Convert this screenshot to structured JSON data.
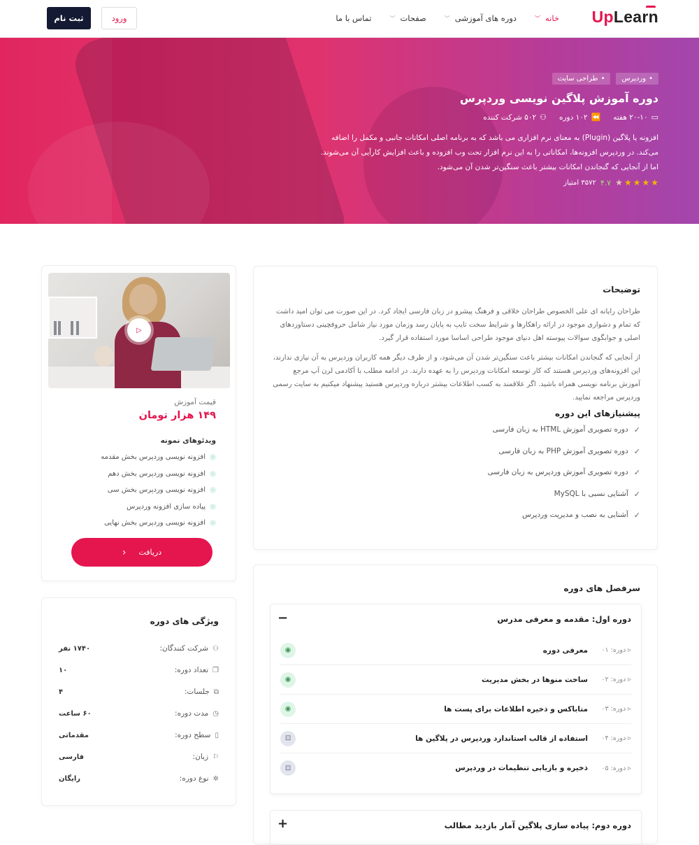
{
  "header": {
    "logo_text": "Learn",
    "logo_accent": "Up",
    "nav": [
      {
        "label": "خانه",
        "active": true
      },
      {
        "label": "دوره های آموزشی",
        "active": false
      },
      {
        "label": "صفحات",
        "active": false
      },
      {
        "label": "تماس با ما",
        "active": false
      }
    ],
    "login_label": "ورود",
    "register_label": "ثبت نام"
  },
  "hero": {
    "tags": [
      "وردپرس",
      "طراحی سایت"
    ],
    "title": "دوره آموزش پلاگین نویسی وردپرس",
    "weeks": "۲۰-۱۰ هفته",
    "lessons": "۱۰۲ دوره",
    "students": "۵۰۲ شرکت کننده",
    "description": "افزونه یا پلاگین (Plugin) به معنای نرم افزاری می باشد که به برنامه اصلی امکانات جانبی و مکمل را اضافه می‌کند. در وردپرس افزونه‌ها، امکاناتی را به این نرم افزار تحت وب افزوده و باعث افزایش کارآیی آن می‌شوند. اما از آنجایی که گنجاندن امکانات بیشتر باعث سنگین‌تر شدن آن می‌شود.",
    "rating_value": "۴.۷",
    "rating_points": "۳۵۷۲ امتیاز",
    "stars_filled": 4,
    "stars_total": 5
  },
  "description_section": {
    "title": "توضیحات",
    "p1": "طراحان رایانه ای علی الخصوص طراحان خلاقی و فرهنگ پیشرو در زبان فارسی ایجاد کرد. در این صورت می توان امید داشت که تمام و دشواری موجود در ارائه راهکارها و شرایط سخت تایپ به پایان رسد وزمان مورد نیاز شامل حروفچینی دستاوردهای اصلی و جوابگوی سوالات پیوسته اهل دنیای موجود طراحی اساسا مورد استفاده قرار گیرد.",
    "p2": "از آنجایی که گنجاندن امکانات بیشتر باعث سنگین‌تر شدن آن می‌شود، و از طرف دیگر همه کاربران وردپرس به آن نیازی ندارند، این افزونه‌های وردپرس هستند که کار توسعه امکانات وردپرس را به عهده دارند. در ادامه مطلب با آکادمی لرن آپ مرجع آموزش برنامه نویسی همراه باشید. اگر علاقمند به کسب اطلاعات بیشتر درباره وردپرس هستید پیشنهاد میکنیم به سایت رسمی وردپرس مراجعه نمایید.",
    "prereq_title": "پیشنیازهای این دوره",
    "prereqs": [
      "دوره تصویری آموزش HTML به زبان فارسی",
      "دوره تصویری آموزش PHP به زبان فارسی",
      "دوره تصویری آموزش وردپرس به زبان فارسی",
      "آشنایی نسبی با MySQL",
      "آشنایی به نصب و مدیریت وردپرس"
    ]
  },
  "sidebar": {
    "price_label": "قیمت آموزش",
    "price": "۱۴۹ هزار تومان",
    "samples_title": "ویدئوهای نمونه",
    "samples": [
      "افزونه نویسی وردپرس بخش مقدمه",
      "افزونه نویسی وردپرس بخش دهم",
      "افزونه نویسی وردپرس بخش سی",
      "پیاده سازی افزونه وردپرس",
      "افزونه نویسی وردپرس بخش نهایی"
    ],
    "get_button": "دریافت"
  },
  "features": {
    "title": "ویژگی های دوره",
    "rows": [
      {
        "icon": "user-icon",
        "label": "شرکت کنندگان:",
        "value": "۱۷۴۰ نفر"
      },
      {
        "icon": "copy-icon",
        "label": "تعداد دوره:",
        "value": "۱۰"
      },
      {
        "icon": "puzzle-icon",
        "label": "جلسات:",
        "value": "۴"
      },
      {
        "icon": "clock-icon",
        "label": "مدت دوره:",
        "value": "۶۰ ساعت"
      },
      {
        "icon": "level-icon",
        "label": "سطح دوره:",
        "value": "مقدماتی"
      },
      {
        "icon": "flag-icon",
        "label": "زبان:",
        "value": "فارسی"
      },
      {
        "icon": "gear-icon",
        "label": "نوع دوره:",
        "value": "رایگان"
      }
    ]
  },
  "curriculum": {
    "title": "سرفصل های دوره",
    "sections": [
      {
        "title": "دوره اول: مقدمه و معرفی مدرس",
        "toggle": "−",
        "lessons": [
          {
            "num": "دوره: ۰۱",
            "title": "معرفی دوره",
            "badge": "eye"
          },
          {
            "num": "دوره: ۰۲",
            "title": "ساخت منوها در بخش مدیریت",
            "badge": "eye"
          },
          {
            "num": "دوره: ۰۳",
            "title": "متاباکس و ذخیره اطلاعات برای پست ها",
            "badge": "eye"
          },
          {
            "num": "دوره: ۰۴",
            "title": "استفاده از قالب استاندارد وردپرس در پلاگین ها",
            "badge": "lock"
          },
          {
            "num": "دوره: ۰۵",
            "title": "ذخیره و بازیابی تنظیمات در وردپرس",
            "badge": "lock"
          }
        ]
      },
      {
        "title": "دوره دوم: پیاده سازی پلاگین آمار بازدید مطالب",
        "toggle": "+"
      }
    ]
  },
  "colors": {
    "accent": "#e5154e",
    "dark_button": "#141a33"
  }
}
